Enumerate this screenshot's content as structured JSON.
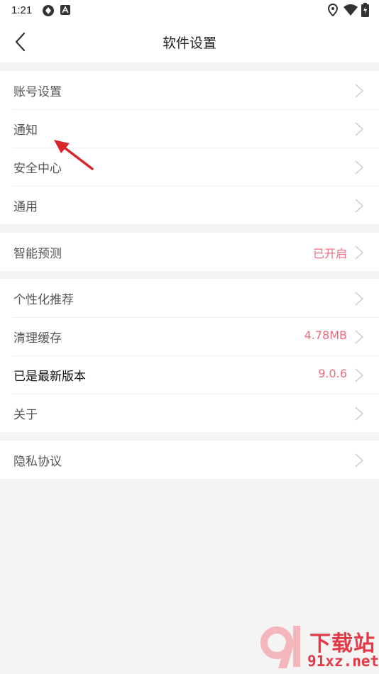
{
  "status_bar": {
    "time": "1:21"
  },
  "header": {
    "title": "软件设置"
  },
  "groups": [
    {
      "items": [
        {
          "label": "账号设置",
          "value": ""
        },
        {
          "label": "通知",
          "value": ""
        },
        {
          "label": "安全中心",
          "value": ""
        },
        {
          "label": "通用",
          "value": ""
        }
      ]
    },
    {
      "items": [
        {
          "label": "智能预测",
          "value": "已开启"
        }
      ]
    },
    {
      "items": [
        {
          "label": "个性化推荐",
          "value": ""
        },
        {
          "label": "清理缓存",
          "value": "4.78MB"
        },
        {
          "label": "已是最新版本",
          "value": "9.0.6"
        },
        {
          "label": "关于",
          "value": ""
        }
      ]
    },
    {
      "items": [
        {
          "label": "隐私协议",
          "value": ""
        }
      ]
    }
  ],
  "watermark": {
    "name": "下载站",
    "domain": "91xz.net"
  },
  "colors": {
    "accent": "#ef6b7e",
    "annotation_arrow": "#d9262b",
    "watermark": "#e23b47"
  }
}
